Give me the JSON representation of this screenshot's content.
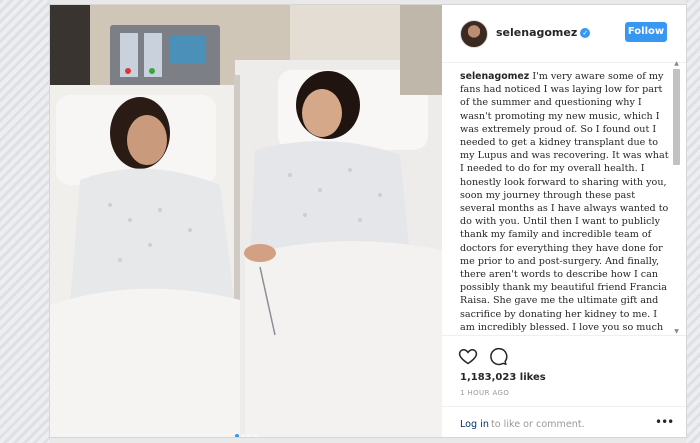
{
  "post": {
    "username": "selenagomez",
    "verified": true,
    "follow_label": "Follow",
    "caption_username": "selenagomez",
    "caption_text": "I'm very aware some of my fans had noticed I was laying low for part of the summer and questioning why I wasn't promoting my new music, which I was extremely proud of. So I found out I needed to get a kidney transplant due to my Lupus and was recovering. It was what I needed to do for my overall health. I honestly look forward to sharing with you, soon my journey through these past several months as I have always wanted to do with you. Until then I want to publicly thank my family and incredible team of doctors for everything they have done for me prior to and post-surgery. And finally, there aren't words to describe how I can possibly thank my beautiful friend Francia Raisa. She gave me the ultimate gift and sacrifice by donating her kidney to me. I am incredibly blessed. I love you so much sis.",
    "likes": "1,183,023 likes",
    "time_ago": "1 HOUR AGO",
    "login_link": "Log in",
    "login_rest": "to like or comment.",
    "more_glyph": "•••",
    "carousel": {
      "count": 4,
      "active_index": 0
    }
  },
  "icons": {
    "like": "heart-icon",
    "comment": "comment-icon",
    "more": "more-options-icon",
    "verified": "verified-badge-icon"
  },
  "colors": {
    "accent": "#3897f0",
    "text": "#262626",
    "muted": "#999999",
    "link": "#003569"
  }
}
